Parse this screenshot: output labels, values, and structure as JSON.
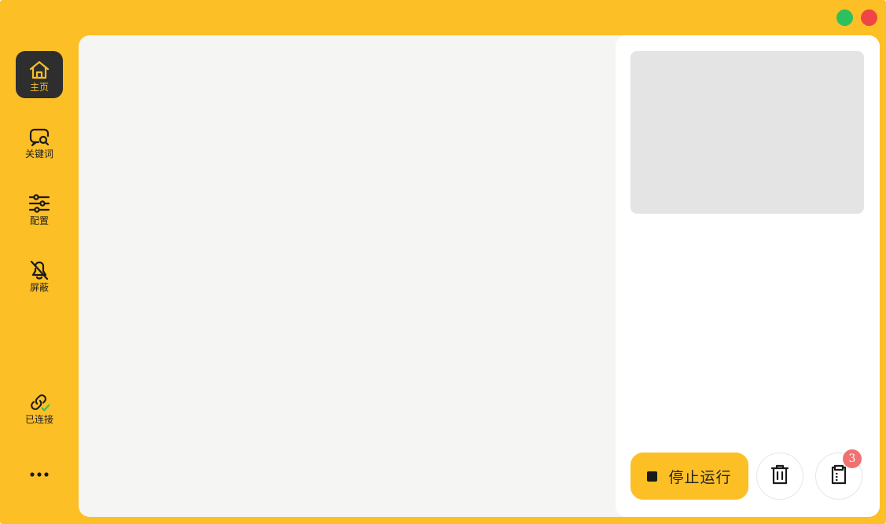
{
  "window": {
    "controls": [
      {
        "name": "maximize",
        "color": "#2CC15C"
      },
      {
        "name": "close",
        "color": "#F04545"
      }
    ]
  },
  "colors": {
    "accent": "#FCBF26",
    "active_nav_bg": "#2E2E2E",
    "badge": "#F07171"
  },
  "sidebar": {
    "items": [
      {
        "icon": "home-icon",
        "label": "主页",
        "active": true
      },
      {
        "icon": "search-chat-icon",
        "label": "关键词",
        "active": false
      },
      {
        "icon": "sliders-icon",
        "label": "配置",
        "active": false
      },
      {
        "icon": "bell-off-icon",
        "label": "屏蔽",
        "active": false
      }
    ],
    "connection": {
      "icon": "link-check-icon",
      "label": "已连接"
    },
    "more": {
      "icon": "more-dots-icon"
    }
  },
  "right_panel": {
    "stop_button": {
      "icon": "stop-icon",
      "label": "停止运行"
    },
    "trash_button": {
      "icon": "trash-icon"
    },
    "clipboard_button": {
      "icon": "clipboard-icon",
      "badge": "3"
    }
  }
}
